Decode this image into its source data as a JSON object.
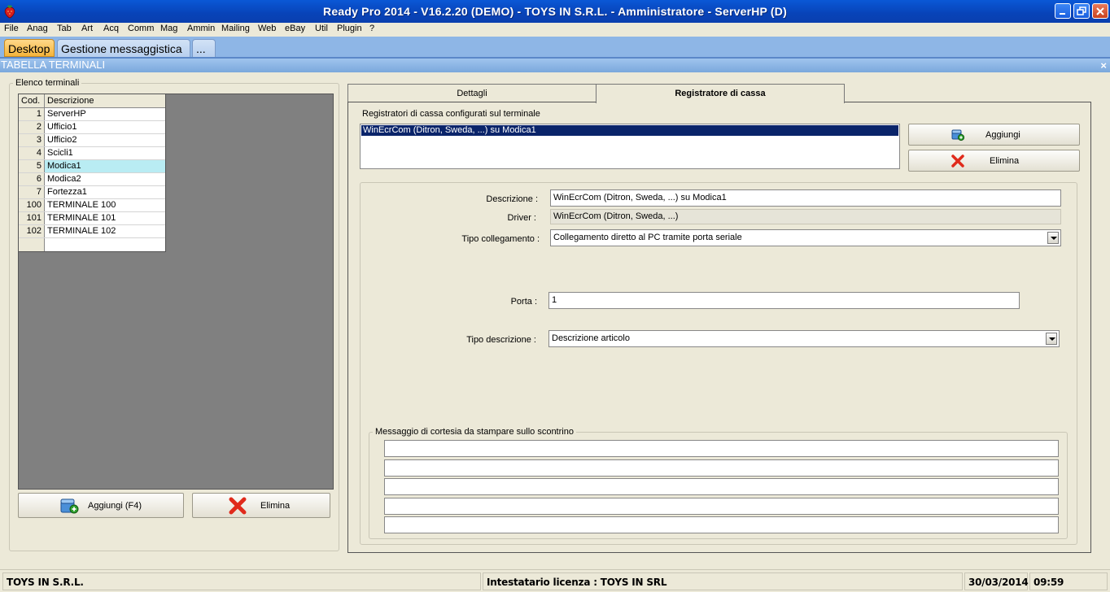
{
  "window": {
    "title": "Ready Pro 2014 - V16.2.20 (DEMO)  - TOYS IN S.R.L. - Amministratore - ServerHP (D)"
  },
  "menu": [
    "File",
    "Anag",
    "Tab",
    "Art",
    "Acq",
    "Comm",
    "Mag",
    "Ammin",
    "Mailing",
    "Web",
    "eBay",
    "Util",
    "Plugin",
    "?"
  ],
  "tabs": {
    "desktop": "Desktop",
    "messaging": "Gestione messaggistica",
    "more": "..."
  },
  "panel": {
    "title": "TABELLA TERMINALI",
    "close": "×"
  },
  "terminals": {
    "caption": "Elenco terminali",
    "headers": {
      "cod": "Cod.",
      "desc": "Descrizione"
    },
    "rows": [
      {
        "cod": "1",
        "desc": "ServerHP"
      },
      {
        "cod": "2",
        "desc": "Ufficio1"
      },
      {
        "cod": "3",
        "desc": "Ufficio2"
      },
      {
        "cod": "4",
        "desc": "Scicli1"
      },
      {
        "cod": "5",
        "desc": "Modica1"
      },
      {
        "cod": "6",
        "desc": "Modica2"
      },
      {
        "cod": "7",
        "desc": "Fortezza1"
      },
      {
        "cod": "100",
        "desc": "TERMINALE 100"
      },
      {
        "cod": "101",
        "desc": "TERMINALE 101"
      },
      {
        "cod": "102",
        "desc": "TERMINALE 102"
      },
      {
        "cod": "",
        "desc": ""
      }
    ],
    "add_label": "Aggiungi (F4)",
    "delete_label": "Elimina"
  },
  "right_tabs": {
    "details": "Dettagli",
    "register": "Registratore di cassa"
  },
  "register": {
    "list_caption": "Registratori di cassa configurati sul terminale",
    "items": [
      "WinEcrCom (Ditron, Sweda, ...) su Modica1"
    ],
    "add_label": "Aggiungi",
    "delete_label": "Elimina",
    "labels": {
      "descrizione": "Descrizione :",
      "driver": "Driver :",
      "tipo_collegamento": "Tipo collegamento :",
      "porta": "Porta :",
      "tipo_descrizione": "Tipo descrizione :"
    },
    "values": {
      "descrizione": "WinEcrCom (Ditron, Sweda, ...) su Modica1",
      "driver": "WinEcrCom (Ditron, Sweda, ...)",
      "tipo_collegamento": "Collegamento diretto al PC tramite porta seriale",
      "porta": "1",
      "tipo_descrizione": "Descrizione articolo"
    },
    "message_caption": "Messaggio di cortesia da stampare sullo scontrino"
  },
  "status": {
    "company": "TOYS IN S.R.L.",
    "license": "Intestatario licenza : TOYS IN SRL",
    "date": "30/03/2014",
    "time": "09:59"
  }
}
